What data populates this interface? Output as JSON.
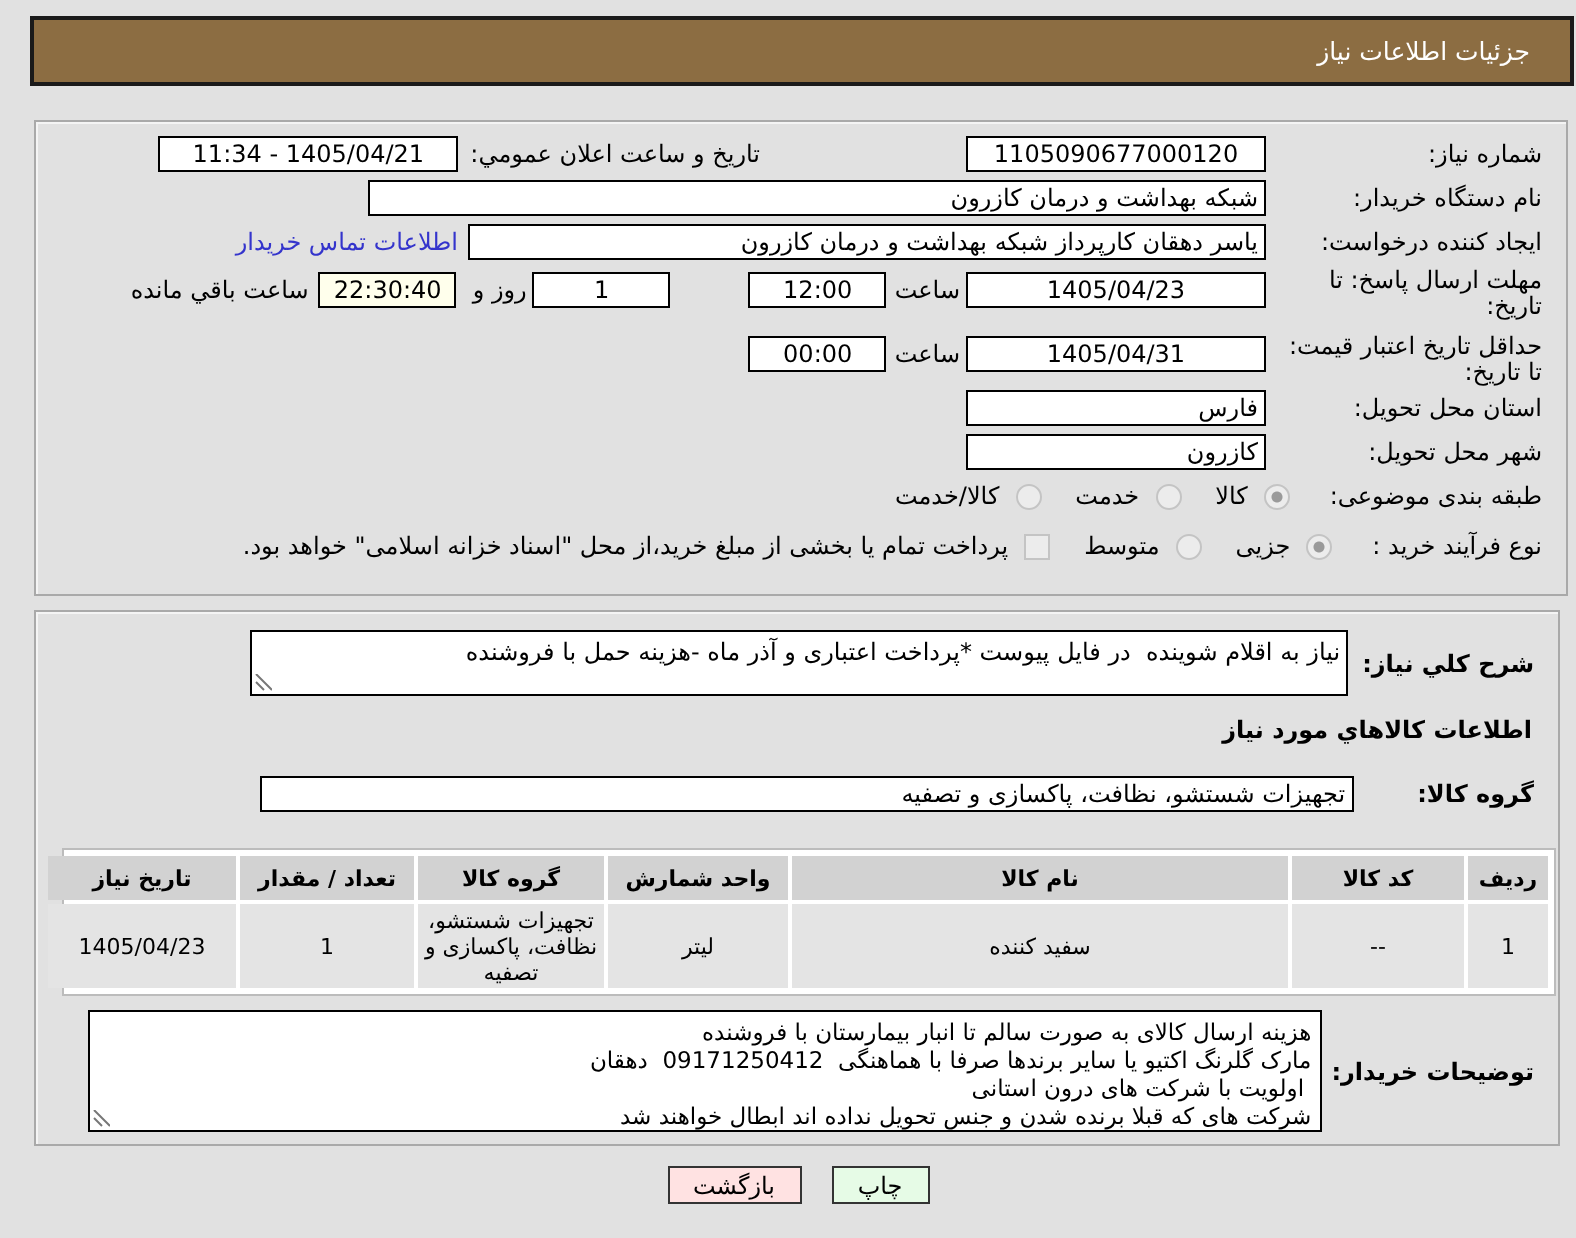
{
  "header": {
    "title": "جزئیات اطلاعات نیاز"
  },
  "details": {
    "need_number": {
      "label": "شماره نیاز:",
      "value": "1105090677000120"
    },
    "announce": {
      "label": "تاریخ و ساعت اعلان عمومي:",
      "value": "1405/04/21 - 11:34"
    },
    "buyer_org": {
      "label": "نام دستگاه خریدار:",
      "value": "شبکه بهداشت و درمان کازرون"
    },
    "requester": {
      "label": "ایجاد کننده درخواست:",
      "value": "یاسر دهقان کارپرداز شبکه بهداشت و درمان کازرون",
      "link": "اطلاعات تماس خریدار"
    },
    "reply_deadline": {
      "label": "مهلت ارسال پاسخ: تا تاریخ:",
      "date": "1405/04/23",
      "time_label": "ساعت",
      "time": "12:00",
      "days": "1",
      "days_label": "روز و",
      "remaining": "22:30:40",
      "remaining_label": "ساعت باقي مانده"
    },
    "price_validity": {
      "label": "حداقل تاریخ اعتبار قیمت: تا تاریخ:",
      "date": "1405/04/31",
      "time_label": "ساعت",
      "time": "00:00"
    },
    "province": {
      "label": "استان محل تحویل:",
      "value": "فارس"
    },
    "city": {
      "label": "شهر محل تحویل:",
      "value": "کازرون"
    },
    "category": {
      "label": "طبقه بندی موضوعی:",
      "options": [
        {
          "label": "کالا",
          "selected": true
        },
        {
          "label": "خدمت",
          "selected": false
        },
        {
          "label": "کالا/خدمت",
          "selected": false
        }
      ]
    },
    "process": {
      "label": "نوع فرآیند خرید :",
      "options": [
        {
          "label": "جزیی",
          "selected": true
        },
        {
          "label": "متوسط",
          "selected": false
        }
      ],
      "treasury": {
        "label": "پرداخت تمام یا بخشی از مبلغ خرید،از محل \"اسناد خزانه اسلامی\" خواهد بود.",
        "checked": false
      }
    }
  },
  "description": {
    "label": "شرح کلي نیاز:",
    "value": "نیاز به اقلام شوینده  در فایل پیوست *پرداخت اعتباری و آذر ماه -هزینه حمل با فروشنده"
  },
  "goods": {
    "title": "اطلاعات کالاهاي مورد نیاز",
    "group_label": "گروه کالا:",
    "group_value": "تجهیزات شستشو، نظافت، پاکسازی و تصفیه",
    "table": {
      "columns": [
        "ردیف",
        "کد کالا",
        "نام کالا",
        "واحد شمارش",
        "گروه کالا",
        "تعداد / مقدار",
        "تاریخ نیاز"
      ],
      "rows": [
        [
          "1",
          "--",
          "سفید کننده",
          "لیتر",
          "تجهیزات شستشو، نظافت، پاکسازی و تصفیه",
          "1",
          "1405/04/23"
        ]
      ]
    }
  },
  "buyer_notes": {
    "label": "توضیحات خریدار:",
    "lines": [
      "هزینه ارسال کالای به صورت سالم تا انبار بیمارستان با فروشنده",
      "مارک گلرنگ اکتیو یا سایر برندها صرفا با هماهنگی  09171250412  دهقان",
      " اولویت با شرکت های درون استانی",
      "شرکت های که قبلا برنده شدن و جنس تحویل نداده اند ابطال خواهند شد"
    ]
  },
  "buttons": [
    {
      "label": "چاپ",
      "kind": "print"
    },
    {
      "label": "بازگشت",
      "kind": "back"
    }
  ]
}
